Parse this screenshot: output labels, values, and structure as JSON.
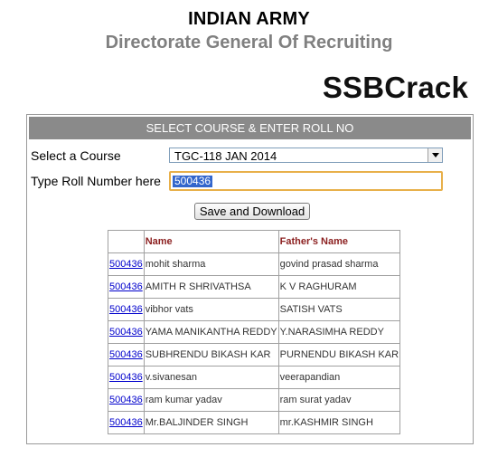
{
  "header": {
    "title": "INDIAN ARMY",
    "subtitle": "Directorate General Of Recruiting",
    "brand": "SSBCrack"
  },
  "panel": {
    "heading": "SELECT COURSE & ENTER ROLL NO",
    "course_label": "Select a Course",
    "course_selected": "TGC-118 JAN 2014",
    "roll_label": "Type Roll Number here",
    "roll_value": "500436",
    "submit_label": "Save and Download"
  },
  "results": {
    "columns": [
      "",
      "Name",
      "Father's Name"
    ],
    "rows": [
      {
        "roll": "500436",
        "name": "mohit sharma",
        "father": "govind prasad sharma"
      },
      {
        "roll": "500436",
        "name": "AMITH R SHRIVATHSA",
        "father": "K V RAGHURAM"
      },
      {
        "roll": "500436",
        "name": "vibhor vats",
        "father": "SATISH VATS"
      },
      {
        "roll": "500436",
        "name": "YAMA MANIKANTHA REDDY",
        "father": "Y.NARASIMHA REDDY"
      },
      {
        "roll": "500436",
        "name": "SUBHRENDU BIKASH KAR",
        "father": "PURNENDU BIKASH KAR"
      },
      {
        "roll": "500436",
        "name": "v.sivanesan",
        "father": "veerapandian"
      },
      {
        "roll": "500436",
        "name": "ram kumar yadav",
        "father": "ram surat yadav"
      },
      {
        "roll": "500436",
        "name": "Mr.BALJINDER SINGH",
        "father": "mr.KASHMIR SINGH"
      }
    ]
  },
  "colors": {
    "panel_header_bg": "#8a8a8a",
    "column_header_text": "#8b1f1f",
    "link": "#0000cc",
    "input_focus_border": "#e8b04a",
    "selection_highlight": "#3366cc"
  },
  "icons": {
    "select_arrow": "chevron-down-icon"
  }
}
